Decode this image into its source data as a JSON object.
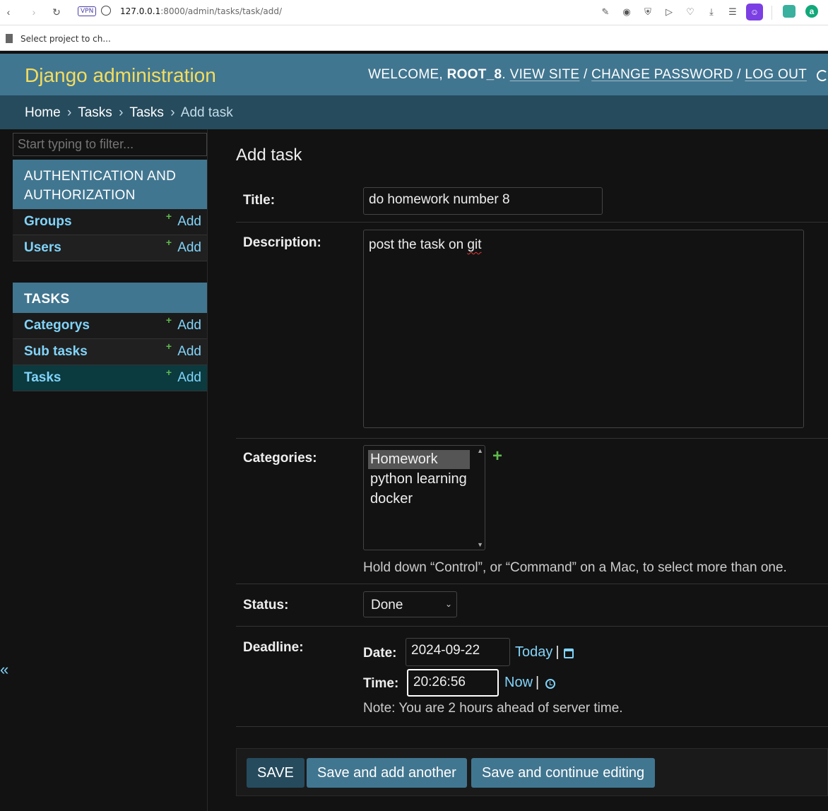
{
  "browser": {
    "vpn_label": "VPN",
    "url_host": "127.0.0.1",
    "url_rest": ":8000/admin/tasks/task/add/",
    "bookmark_label": "Select project to ch..."
  },
  "header": {
    "branding": "Django administration",
    "welcome": "WELCOME, ",
    "username": "ROOT_8",
    "view_site": "VIEW SITE",
    "change_password": "CHANGE PASSWORD",
    "log_out": "LOG OUT",
    "sep": " / "
  },
  "breadcrumbs": {
    "home": "Home",
    "app": "Tasks",
    "model": "Tasks",
    "current": "Add task",
    "sep": "›"
  },
  "sidebar": {
    "filter_placeholder": "Start typing to filter...",
    "collapse": "«",
    "apps": [
      {
        "caption": "AUTHENTICATION AND AUTHORIZATION",
        "models": [
          {
            "name": "Groups",
            "add": "Add"
          },
          {
            "name": "Users",
            "add": "Add"
          }
        ]
      },
      {
        "caption": "TASKS",
        "models": [
          {
            "name": "Categorys",
            "add": "Add"
          },
          {
            "name": "Sub tasks",
            "add": "Add"
          },
          {
            "name": "Tasks",
            "add": "Add"
          }
        ]
      }
    ]
  },
  "main": {
    "title": "Add task",
    "fields": {
      "title_label": "Title:",
      "title_value": "do homework number 8",
      "description_label": "Description:",
      "description_word1": "post the task on ",
      "description_word2": "git",
      "categories_label": "Categories:",
      "categories_options": [
        "Homework",
        "python learning",
        "docker"
      ],
      "categories_selected": "Homework",
      "categories_help": "Hold down “Control”, or “Command” on a Mac, to select more than one.",
      "status_label": "Status:",
      "status_value": "Done",
      "deadline_label": "Deadline:",
      "date_label": "Date:",
      "date_value": "2024-09-22",
      "today_link": "Today",
      "time_label": "Time:",
      "time_value": "20:26:56",
      "now_link": "Now",
      "pipe": "|",
      "tz_note": "Note: You are 2 hours ahead of server time."
    },
    "buttons": {
      "save": "SAVE",
      "save_add_another": "Save and add another",
      "save_continue": "Save and continue editing"
    }
  },
  "colors": {
    "header_bg": "#417690",
    "branding": "#f5dd5d",
    "breadcrumbs_bg": "#264b5d",
    "link": "#81d4fa",
    "add_plus": "#5fb94d",
    "page_bg": "#121212"
  }
}
